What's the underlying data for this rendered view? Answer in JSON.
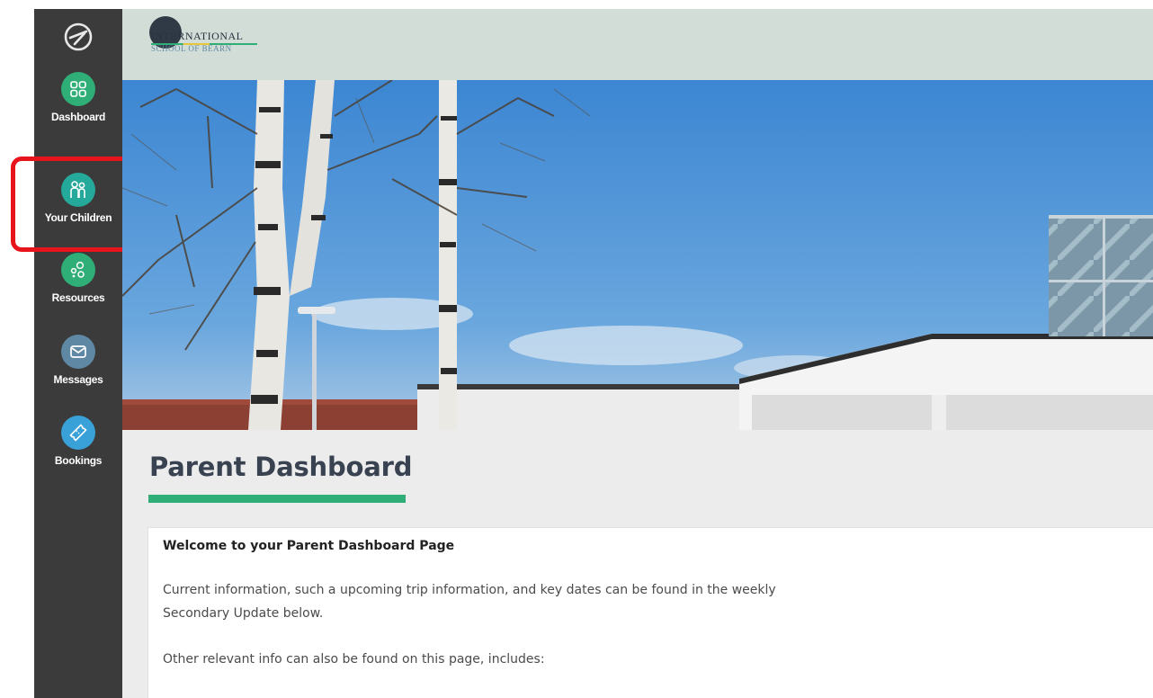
{
  "sidebar": {
    "items": [
      {
        "label": "Dashboard",
        "icon": "grid-icon",
        "color": "#2fae77"
      },
      {
        "label": "Your Children",
        "icon": "children-icon",
        "color": "#25a99a"
      },
      {
        "label": "Resources",
        "icon": "resources-icon",
        "color": "#2fae77"
      },
      {
        "label": "Messages",
        "icon": "envelope-icon",
        "color": "#5e88a3"
      },
      {
        "label": "Bookings",
        "icon": "ticket-icon",
        "color": "#3aa1d8"
      }
    ],
    "highlighted_item": "Your Children",
    "highlight_color": "#e8141c"
  },
  "header": {
    "school_name_line1": "INTERNATIONAL",
    "school_name_line2": "SCHOOL OF BEARN"
  },
  "main": {
    "page_title": "Parent Dashboard",
    "accent_color": "#2fae77",
    "card": {
      "heading": "Welcome to your Parent Dashboard Page",
      "paragraph1": "Current information, such a upcoming trip information, and key dates can be found in the weekly Secondary Update below.",
      "paragraph2": "Other relevant info can also be found on this page, includes:"
    }
  }
}
